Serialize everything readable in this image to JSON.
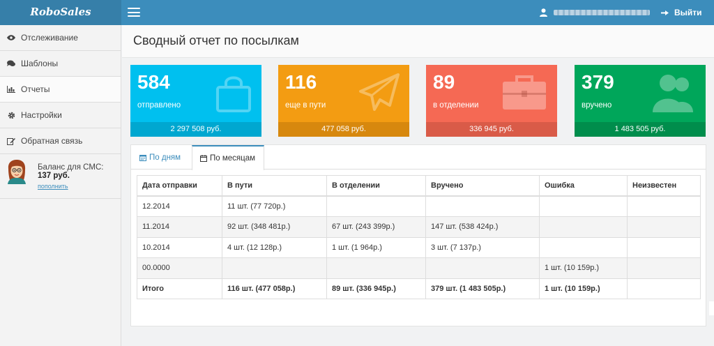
{
  "app": {
    "logo": "RoboSales"
  },
  "header": {
    "logout_label": "Выйти"
  },
  "sidebar": {
    "items": [
      {
        "label": "Отслеживание"
      },
      {
        "label": "Шаблоны"
      },
      {
        "label": "Отчеты"
      },
      {
        "label": "Настройки"
      },
      {
        "label": "Обратная связь"
      }
    ],
    "balance": {
      "label": "Баланс для СМС:",
      "amount": "137 руб.",
      "topup_link": "пополнить"
    }
  },
  "page": {
    "title": "Сводный отчет по посылкам"
  },
  "cards": [
    {
      "number": "584",
      "label": "отправлено",
      "sum": "2 297 508 руб.",
      "color": "#00c0ef",
      "footer_color": "#00a7d0",
      "icon": "shopping-bag-icon"
    },
    {
      "number": "116",
      "label": "еще в пути",
      "sum": "477 058 руб.",
      "color": "#f39c12",
      "footer_color": "#d7880e",
      "icon": "paper-plane-icon"
    },
    {
      "number": "89",
      "label": "в отделении",
      "sum": "336 945 руб.",
      "color": "#f56954",
      "footer_color": "#d95b48",
      "icon": "briefcase-icon"
    },
    {
      "number": "379",
      "label": "вручено",
      "sum": "1 483 505 руб.",
      "color": "#00a65a",
      "footer_color": "#008d4c",
      "icon": "users-icon"
    }
  ],
  "tabs": [
    {
      "label": "По дням"
    },
    {
      "label": "По месяцам"
    }
  ],
  "table": {
    "headers": [
      "Дата отправки",
      "В пути",
      "В отделении",
      "Вручено",
      "Ошибка",
      "Неизвестен"
    ],
    "rows": [
      [
        "12.2014",
        "11 шт. (77 720р.)",
        "",
        "",
        "",
        ""
      ],
      [
        "11.2014",
        "92 шт. (348 481р.)",
        "67 шт. (243 399р.)",
        "147 шт. (538 424р.)",
        "",
        ""
      ],
      [
        "10.2014",
        "4 шт. (12 128р.)",
        "1 шт. (1 964р.)",
        "3 шт. (7 137р.)",
        "",
        ""
      ],
      [
        "00.0000",
        "",
        "",
        "",
        "1 шт. (10 159р.)",
        ""
      ]
    ],
    "total": [
      "Итого",
      "116 шт. (477 058р.)",
      "89 шт. (336 945р.)",
      "379 шт. (1 483 505р.)",
      "1 шт. (10 159р.)",
      ""
    ]
  }
}
